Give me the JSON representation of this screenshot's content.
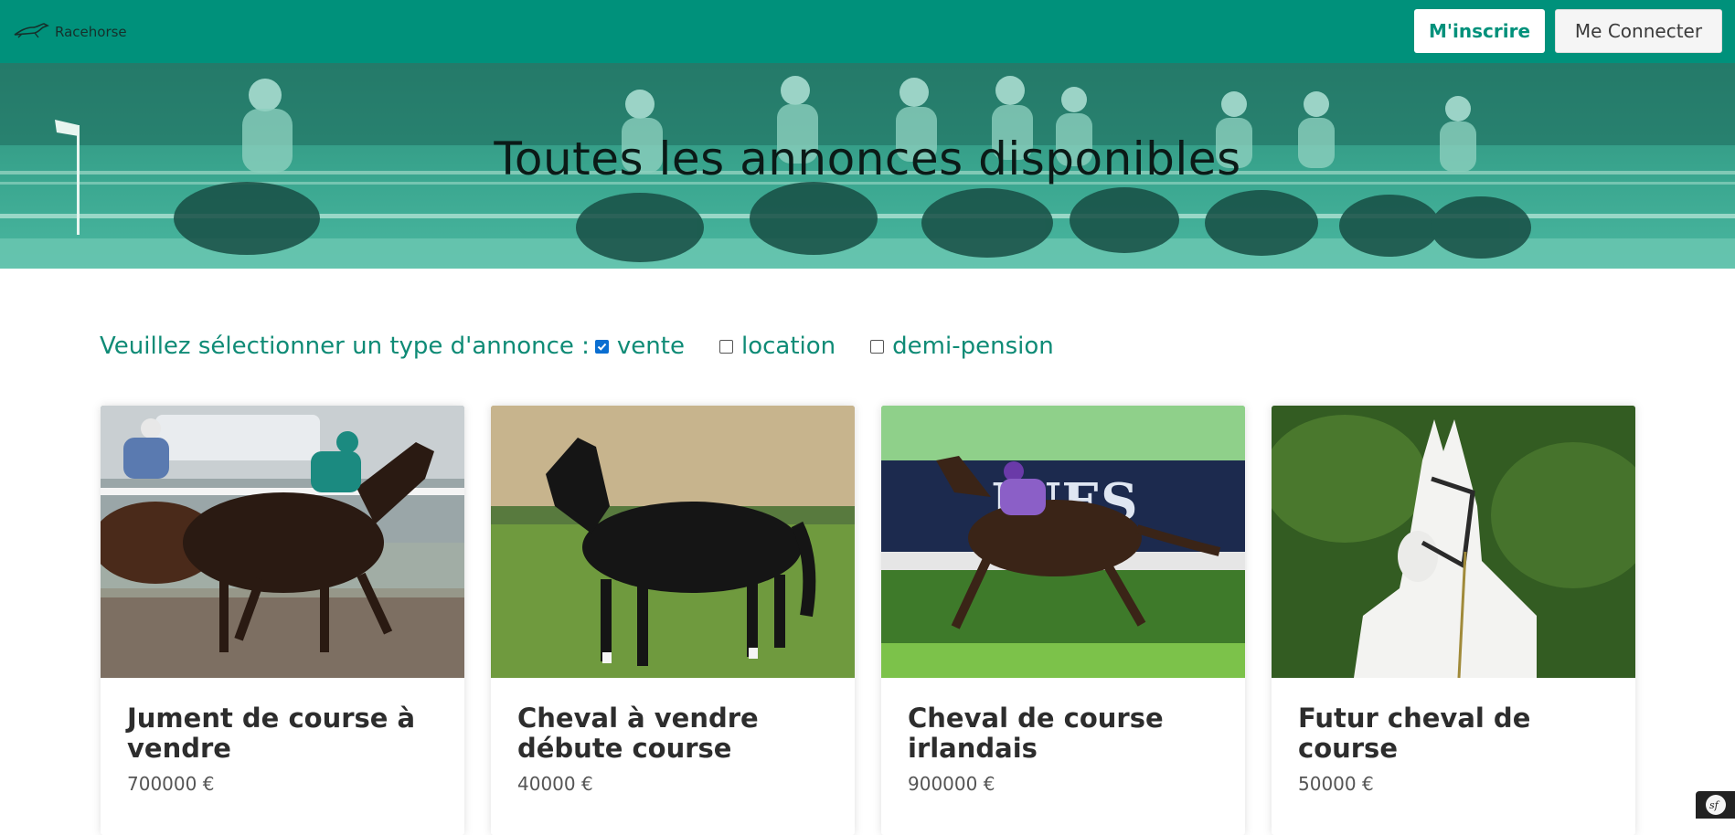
{
  "navbar": {
    "brand": "Racehorse",
    "register_label": "M'inscrire",
    "login_label": "Me Connecter"
  },
  "hero": {
    "title": "Toutes les annonces disponibles"
  },
  "filter": {
    "prompt": "Veuillez sélectionner un type d'annonce :",
    "options": [
      {
        "label": "vente",
        "checked": true
      },
      {
        "label": "location",
        "checked": false
      },
      {
        "label": "demi-pension",
        "checked": false
      }
    ]
  },
  "listings": [
    {
      "title": "Jument de course à vendre",
      "price": "700000 €"
    },
    {
      "title": "Cheval à vendre débute course",
      "price": "40000 €"
    },
    {
      "title": "Cheval de course irlandais",
      "price": "900000 €"
    },
    {
      "title": "Futur cheval de course",
      "price": "50000 €"
    }
  ],
  "colors": {
    "brand": "#00917b",
    "hero_tint": "#3aa68f",
    "checkbox_checked": "#0a6ed1"
  },
  "icons": {
    "brand": "horse-logo-icon",
    "debug": "symfony-icon"
  }
}
